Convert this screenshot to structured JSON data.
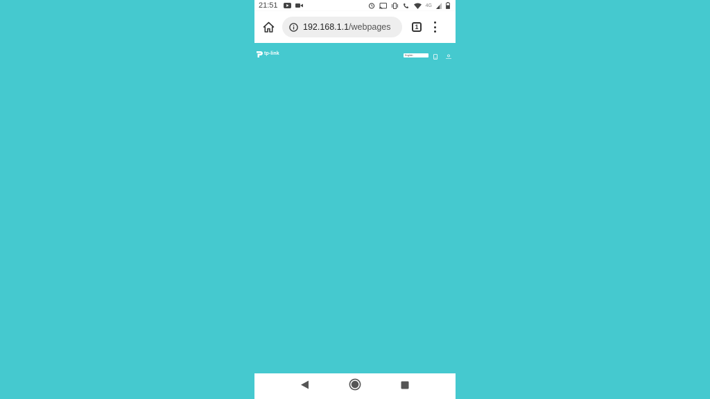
{
  "status_bar": {
    "time": "21:51",
    "network_label": "4G",
    "left_icons": [
      "youtube-icon",
      "video-camera-icon"
    ],
    "right_icons": [
      "alarm-icon",
      "cast-icon",
      "vibrate-icon",
      "wifi-call-icon",
      "wifi-icon",
      "signal-icon",
      "battery-icon"
    ]
  },
  "browser": {
    "url_host": "192.168.1.1",
    "url_path": "/webpages",
    "tab_count": "1"
  },
  "page": {
    "logo_text": "tp-link",
    "background_color": "#45c9cf",
    "language_select": "English"
  },
  "navigation": {
    "icons": [
      "back-icon",
      "home-circle-icon",
      "recents-icon"
    ]
  }
}
